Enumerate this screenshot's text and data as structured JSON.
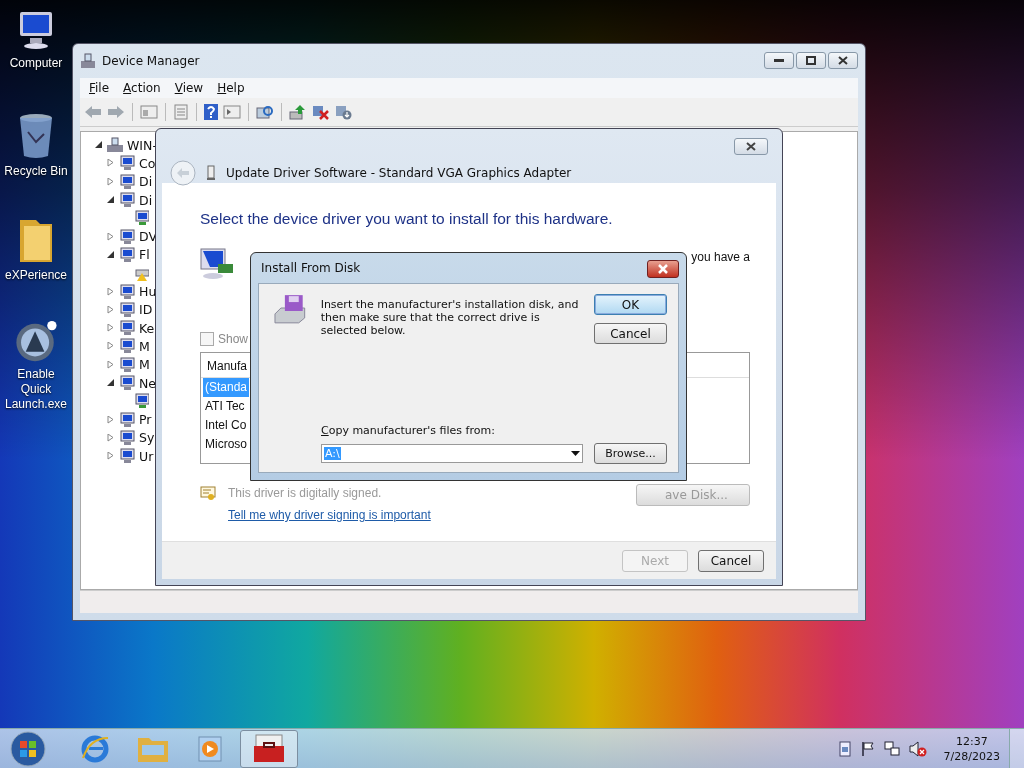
{
  "desktop_icons": [
    {
      "kind": "computer",
      "label": "Computer"
    },
    {
      "kind": "bin",
      "label": "Recycle Bin"
    },
    {
      "kind": "folder",
      "label": "eXPerience"
    },
    {
      "kind": "app",
      "label": "Enable Quick Launch.exe"
    }
  ],
  "device_manager": {
    "title": "Device Manager",
    "menu": [
      "File",
      "Action",
      "View",
      "Help"
    ],
    "tree": {
      "label": "WIN-",
      "expanded": true,
      "children": [
        {
          "label": "Co",
          "expanded": false
        },
        {
          "label": "Di",
          "expanded": false
        },
        {
          "label": "Di",
          "expanded": true,
          "children": [
            {
              "kind": "device"
            }
          ]
        },
        {
          "label": "DV",
          "expanded": false
        },
        {
          "label": "Fl",
          "expanded": true,
          "children": [
            {
              "kind": "warning"
            }
          ]
        },
        {
          "label": "Hu",
          "expanded": false
        },
        {
          "label": "ID",
          "expanded": false
        },
        {
          "label": "Ke",
          "expanded": false
        },
        {
          "label": "M",
          "expanded": false
        },
        {
          "label": "M",
          "expanded": false
        },
        {
          "label": "Ne",
          "expanded": true,
          "children": [
            {
              "kind": "device"
            }
          ]
        },
        {
          "label": "Pr",
          "expanded": false
        },
        {
          "label": "Sy",
          "expanded": false
        },
        {
          "label": "Ur",
          "expanded": false
        }
      ]
    }
  },
  "update_driver": {
    "title": "Update Driver Software - Standard VGA Graphics Adapter",
    "heading": "Select the device driver you want to install for this hardware.",
    "side_text": "you have a",
    "show_compatible": {
      "label": "Show",
      "checked": false
    },
    "manufacturers": {
      "header": "Manufa",
      "rows": [
        {
          "label": "(Standa",
          "selected": true
        },
        {
          "label": "ATI Tec",
          "selected": false
        },
        {
          "label": "Intel Co",
          "selected": false
        },
        {
          "label": "Microso",
          "selected": false
        }
      ]
    },
    "have_disk": "ave Disk...",
    "signed_note": "This driver is digitally signed.",
    "link": "Tell me why driver signing is important",
    "buttons": [
      {
        "label": "Next",
        "disabled": true
      },
      {
        "label": "Cancel",
        "disabled": false
      }
    ]
  },
  "install_from_disk": {
    "title": "Install From Disk",
    "message": "Insert the manufacturer's installation disk, and then make sure that the correct drive is selected below.",
    "buttons": [
      {
        "label": "OK",
        "default": true
      },
      {
        "label": "Cancel",
        "default": false
      }
    ],
    "copy_label": "Copy manufacturer's files from:",
    "path": "A:\\",
    "browse": "Browse..."
  },
  "taskbar": {
    "apps": [
      {
        "kind": "ie",
        "selected": false
      },
      {
        "kind": "explorer",
        "selected": false
      },
      {
        "kind": "media",
        "selected": false
      },
      {
        "kind": "toolbox",
        "selected": true
      }
    ],
    "time": "12:37",
    "date": "7/28/2023"
  }
}
